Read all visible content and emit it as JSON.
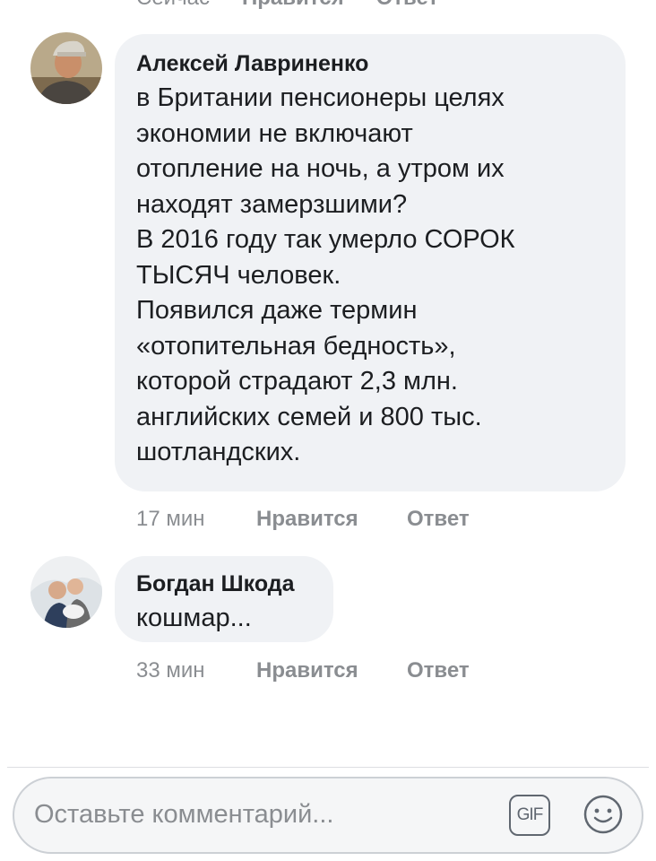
{
  "previous_comment": {
    "time": "Сейчас",
    "like_label": "Нравится",
    "reply_label": "Ответ"
  },
  "comments": [
    {
      "author": "Алексей Лавриненко",
      "text": "в Британии пенсионеры целях\nэкономии не включают\nотопление на ночь, а утром их\nнаходят  замерзшими?\nВ 2016 году так умерло СОРОК\nТЫСЯЧ человек.\nПоявился даже термин\n«отопительная бедность»,\nкоторой  страдают 2,3 млн.\nанглийских семей и 800 тыс.\nшотландских.",
      "time": "17 мин",
      "like_label": "Нравится",
      "reply_label": "Ответ"
    },
    {
      "author": "Богдан Шкода",
      "text": "кошмар...",
      "time": "33 мин",
      "like_label": "Нравится",
      "reply_label": "Ответ"
    }
  ],
  "composer": {
    "placeholder": "Оставьте комментарий...",
    "gif_label": "GIF",
    "gif_icon": "gif-icon",
    "emoji_icon": "smiley-icon"
  },
  "colors": {
    "bubble": "#f0f2f5",
    "meta_text": "#8a8d91",
    "text": "#1c1e21"
  }
}
